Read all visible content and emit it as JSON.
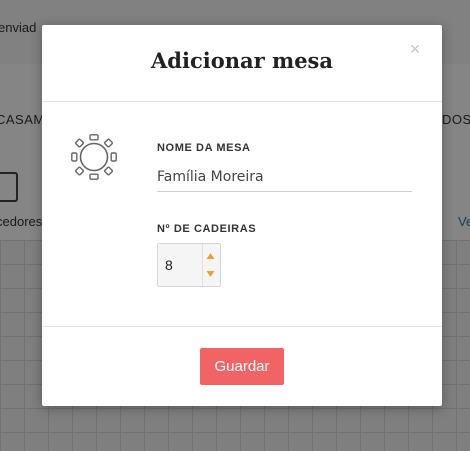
{
  "background": {
    "topbar_text": "enviad",
    "nav_left": "CASAM",
    "nav_right": "DOS",
    "row2_left": "cedores",
    "row2_right": "Ve"
  },
  "modal": {
    "title": "Adicionar mesa",
    "close_symbol": "×",
    "table_icon": "round-table-icon",
    "name_label": "NOME DA MESA",
    "name_value": "Família Moreira",
    "chairs_label": "Nº DE CADEIRAS",
    "chairs_value": "8",
    "save_label": "Guardar"
  },
  "colors": {
    "primary_button": "#f06466",
    "stepper_arrows": "#e8a23a",
    "overlay": "rgba(0,0,0,0.48)"
  }
}
